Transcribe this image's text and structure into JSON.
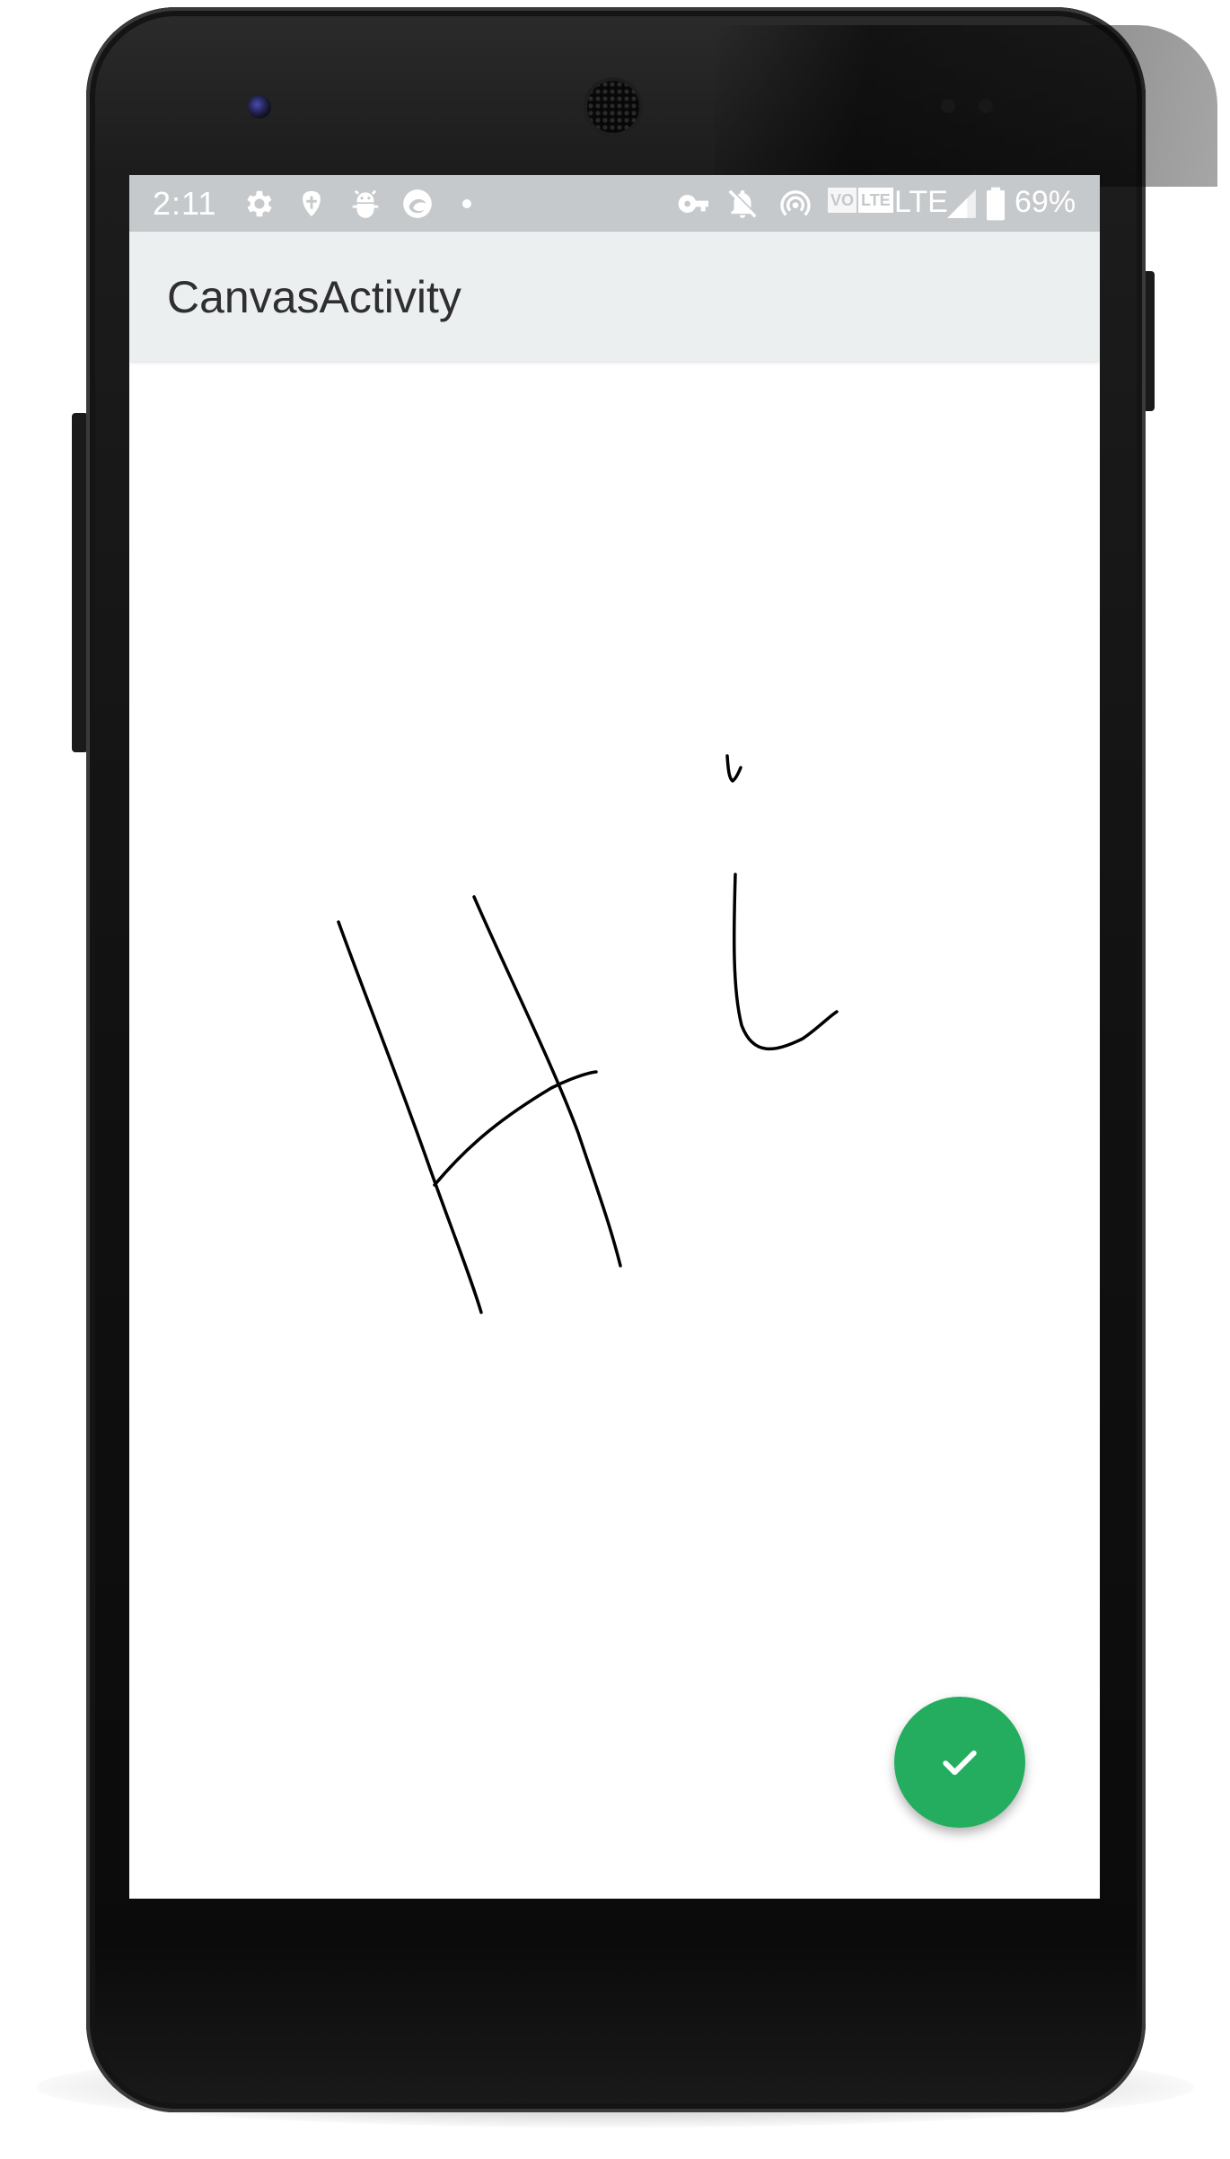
{
  "status_bar": {
    "time": "2:11",
    "battery_percent": "69%",
    "network_label": "LTE",
    "volte_label": "VO",
    "lte_badge": "LTE",
    "icons": [
      "settings-icon",
      "shield-icon",
      "android-debug-icon",
      "edge-app-icon",
      "dot-icon",
      "vpn-key-icon",
      "notifications-off-icon",
      "hotspot-icon",
      "volte-icon",
      "signal-icon",
      "battery-icon"
    ]
  },
  "app_bar": {
    "title": "CanvasActivity"
  },
  "canvas": {
    "drawing_description_icon": "handwritten-strokes",
    "stroke_color": "#000000"
  },
  "fab": {
    "icon": "check-icon",
    "color": "#25ad5f"
  },
  "colors": {
    "status_bar": "#c5c9cb",
    "app_bar": "#eceff0",
    "title_text": "#2f2f2f"
  }
}
